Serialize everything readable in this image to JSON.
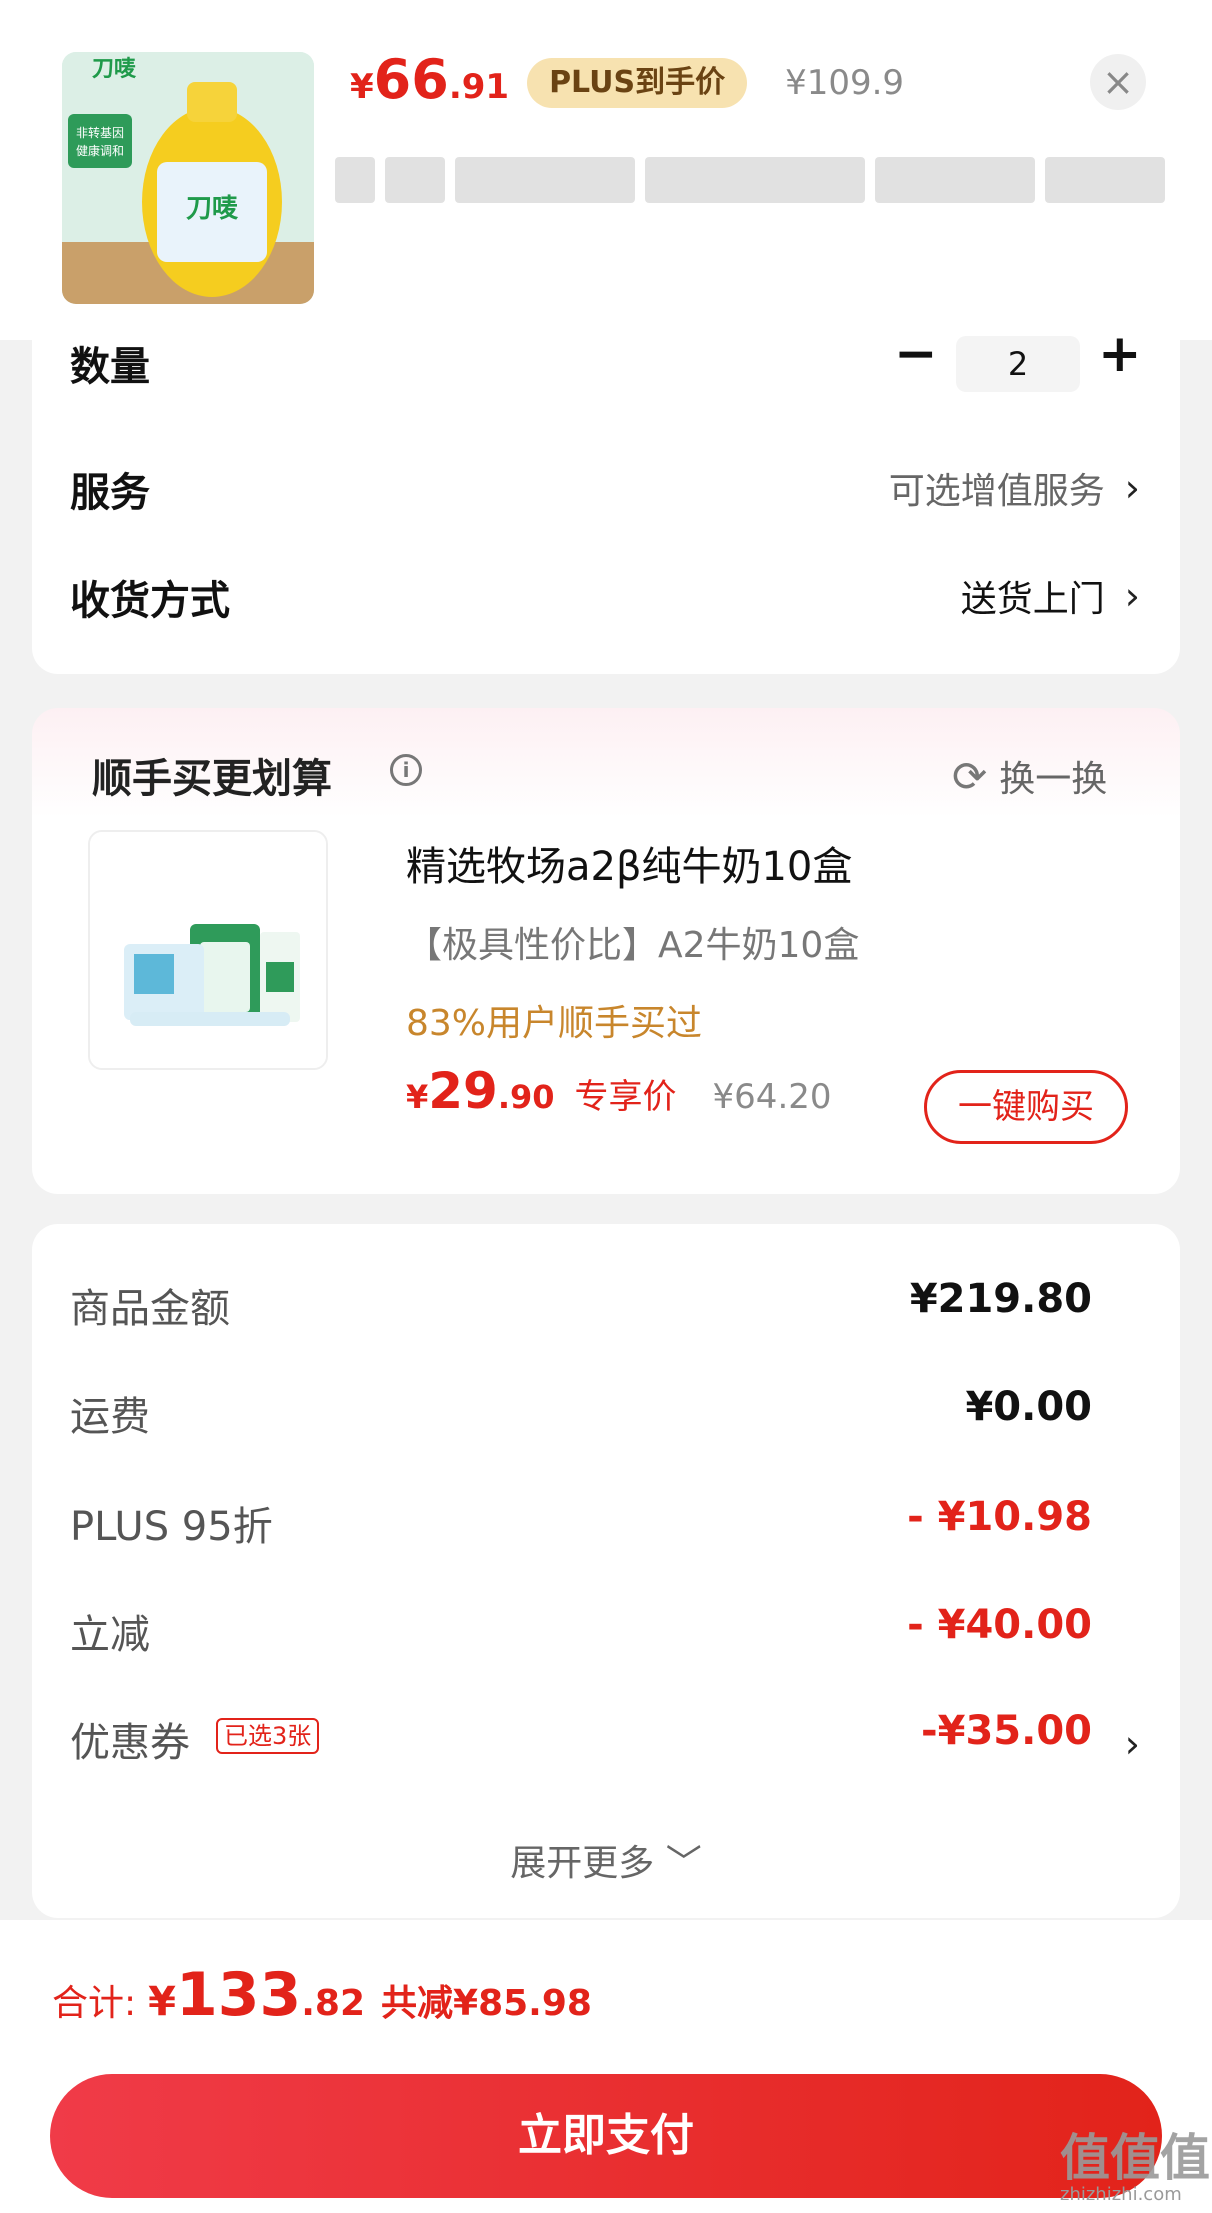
{
  "product": {
    "price_currency": "¥",
    "price_int": "66",
    "price_dec": ".91",
    "plus_tag": "PLUS到手价",
    "orig_price": "¥109.9",
    "close_icon": "close-icon"
  },
  "order": {
    "qty_label": "数量",
    "qty_value": "2",
    "service_label": "服务",
    "service_value": "可选增值服务",
    "delivery_label": "收货方式",
    "delivery_value": "送货上门"
  },
  "upsell": {
    "title": "顺手买更划算",
    "swap": "换一换",
    "name": "精选牧场a2β纯牛奶10盒",
    "subtitle": "【极具性价比】A2牛奶10盒",
    "bought": "83%用户顺手买过",
    "price_currency": "¥",
    "price_int": "29",
    "price_dec": ".90",
    "exclusive": "专享价",
    "orig_price": "¥64.20",
    "buy_button": "一键购买"
  },
  "breakdown": {
    "items": [
      {
        "label": "商品金额",
        "value": "¥219.80"
      },
      {
        "label": "运费",
        "value": "¥0.00"
      },
      {
        "label": "PLUS 95折",
        "value": "- ¥10.98"
      },
      {
        "label": "立减",
        "value": "- ¥40.00"
      },
      {
        "label": "优惠券",
        "value": "-¥35.00"
      }
    ],
    "coupon_tag": "已选3张",
    "expand": "展开更多 ﹀"
  },
  "footer": {
    "total_label": "合计:",
    "total_currency": "¥",
    "total_int": "133",
    "total_dec": ".82",
    "total_saved": "共减¥85.98",
    "pay_button": "立即支付"
  },
  "watermark": {
    "main": "值值值",
    "sub": "zhizhizhi.com"
  },
  "colors": {
    "accent": "#e2231a",
    "plus_tag_bg": "#f7e2b0",
    "gold_text": "#c8862c"
  }
}
